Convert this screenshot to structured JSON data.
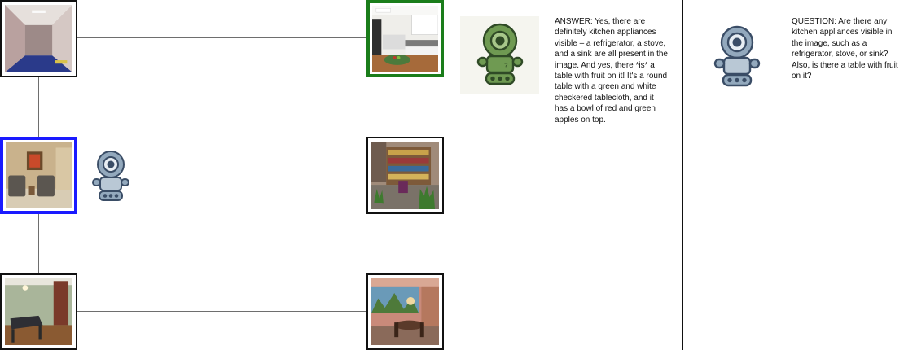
{
  "colors": {
    "current_node_border": "#1a1aff",
    "target_node_border": "#1a7d1a",
    "edge": "#6e6e6e",
    "agent_robot": "blue-gray",
    "oracle_robot": "green"
  },
  "nodes": [
    {
      "id": "hallway",
      "scene": "hallway-with-blue-carpet"
    },
    {
      "id": "kitchen",
      "scene": "white-kitchen-with-table",
      "role": "target"
    },
    {
      "id": "living-room",
      "scene": "room-with-two-armchairs",
      "role": "current"
    },
    {
      "id": "library",
      "scene": "room-with-bookshelves-and-plants"
    },
    {
      "id": "game-room",
      "scene": "room-with-air-hockey-table"
    },
    {
      "id": "dining-room",
      "scene": "dining-room-with-mural"
    }
  ],
  "answer": {
    "text": "ANSWER: Yes, there are definitely kitchen appliances visible – a refrigerator, a stove, and a sink are all present in the image. And yes, there *is* a table with fruit on it! It's a round table with a green and white checkered tablecloth, and it has a bowl of red and green apples on top.",
    "icon": "oracle-robot-icon"
  },
  "question": {
    "text": "QUESTION: Are there any kitchen appliances visible in the image, such as a refrigerator, stove, or sink? Also, is there a table with fruit on it?",
    "icon": "agent-robot-icon"
  }
}
